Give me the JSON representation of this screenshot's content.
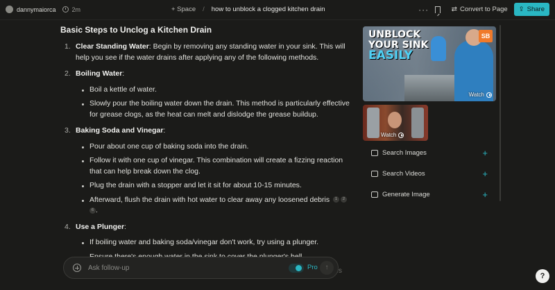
{
  "header": {
    "username": "dannymaiorca",
    "time": "2m",
    "space_label": "+ Space",
    "separator": "/",
    "thread_title": "how to unblock a clogged kitchen drain",
    "menu_label": "···",
    "convert_label": "Convert to Page",
    "share_label": "Share"
  },
  "content": {
    "heading": "Basic Steps to Unclog a Kitchen Drain",
    "steps": [
      {
        "num": "1.",
        "title": "Clear Standing Water",
        "text": ": Begin by removing any standing water in your sink. This will help you see if the water drains after applying any of the following methods."
      },
      {
        "num": "2.",
        "title": "Boiling Water",
        "after": ":",
        "bullets": [
          "Boil a kettle of water.",
          "Slowly pour the boiling water down the drain. This method is particularly effective for grease clogs, as the heat can melt and dislodge the grease buildup."
        ]
      },
      {
        "num": "3.",
        "title": "Baking Soda and Vinegar",
        "after": ":",
        "bullets": [
          "Pour about one cup of baking soda into the drain.",
          "Follow it with one cup of vinegar. This combination will create a fizzing reaction that can help break down the clog.",
          "Plug the drain with a stopper and let it sit for about 10-15 minutes.",
          "Afterward, flush the drain with hot water to clear away any loosened debris"
        ],
        "citations": [
          "1",
          "2",
          "6"
        ]
      },
      {
        "num": "4.",
        "title": "Use a Plunger",
        "after": ":",
        "bullets": [
          "If boiling water and baking soda/vinegar don't work, try using a plunger.",
          "Ensure there's enough water in the sink to cover the plunger's bell."
        ],
        "faded_tail": "This"
      }
    ]
  },
  "sidebar": {
    "video1": {
      "line1": "UNBLOCK",
      "line2": "YOUR SINK",
      "line3": "EASILY",
      "badge": "SB",
      "watch": "Watch"
    },
    "video2": {
      "watch": "Watch"
    },
    "links": [
      {
        "label": "Search Images",
        "icon": "image-icon",
        "plus": "+"
      },
      {
        "label": "Search Videos",
        "icon": "video-icon",
        "plus": "+"
      },
      {
        "label": "Generate Image",
        "icon": "generate-image-icon",
        "plus": "+"
      }
    ]
  },
  "followup": {
    "placeholder": "Ask follow-up",
    "pro_label": "Pro",
    "pro_enabled": true,
    "send_icon": "↑"
  },
  "help": {
    "label": "?"
  },
  "colors": {
    "accent": "#2ab7c3",
    "background": "#1b1b19"
  }
}
